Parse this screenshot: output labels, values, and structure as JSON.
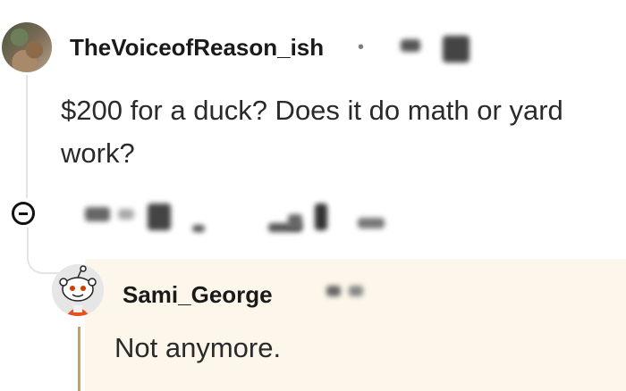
{
  "comment": {
    "username": "TheVoiceofReason_ish",
    "separator": "•",
    "body": "$200 for a duck? Does it do math or yard work?"
  },
  "reply": {
    "username": "Sami_George",
    "body": "Not anymore."
  },
  "icons": {
    "collapse": "collapse-thread-icon",
    "avatar_main": "user-avatar-photo",
    "avatar_reply": "snoo-avatar-icon"
  }
}
